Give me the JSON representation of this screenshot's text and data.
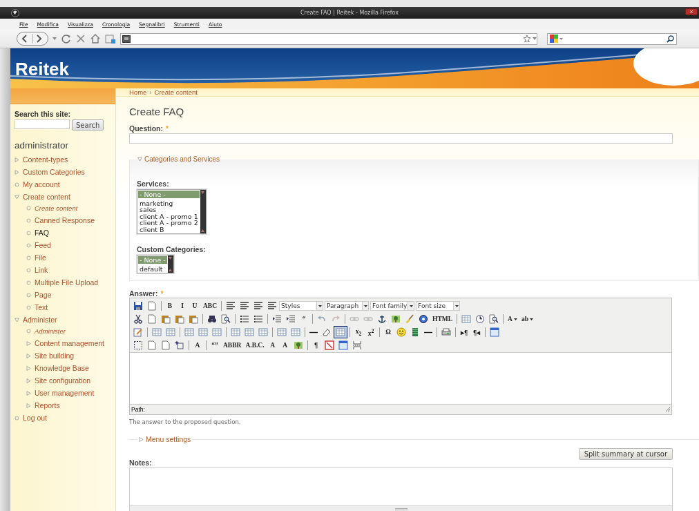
{
  "browser": {
    "title": "Create FAQ | Reitek - Mozilla Firefox",
    "menu": [
      "File",
      "Modifica",
      "Visualizza",
      "Cronologia",
      "Segnalibri",
      "Strumenti",
      "Aiuto"
    ]
  },
  "site": {
    "logo": "Reitek",
    "breadcrumb": {
      "items": [
        "Home",
        "Create content"
      ],
      "separator": "›"
    }
  },
  "sidebar": {
    "search_label": "Search this site:",
    "search_button": "Search",
    "user": "administrator",
    "menu": [
      {
        "label": "Content-types",
        "kind": "branch",
        "expanded": false,
        "selected": false
      },
      {
        "label": "Custom Categories",
        "kind": "branch",
        "expanded": false,
        "selected": false
      },
      {
        "label": "My account",
        "kind": "leaf",
        "selected": false
      },
      {
        "label": "Create content",
        "kind": "branch",
        "expanded": true,
        "selected": false,
        "children": [
          {
            "label": "Create content",
            "kind": "overview",
            "selected": false
          },
          {
            "label": "Canned Response",
            "kind": "leaf",
            "selected": false
          },
          {
            "label": "FAQ",
            "kind": "leaf",
            "selected": true
          },
          {
            "label": "Feed",
            "kind": "leaf",
            "selected": false
          },
          {
            "label": "File",
            "kind": "leaf",
            "selected": false
          },
          {
            "label": "Link",
            "kind": "leaf",
            "selected": false
          },
          {
            "label": "Multiple File Upload",
            "kind": "leaf",
            "selected": false
          },
          {
            "label": "Page",
            "kind": "leaf",
            "selected": false
          },
          {
            "label": "Text",
            "kind": "leaf",
            "selected": false
          }
        ]
      },
      {
        "label": "Administer",
        "kind": "branch",
        "expanded": true,
        "selected": false,
        "children": [
          {
            "label": "Administer",
            "kind": "overview",
            "selected": false
          },
          {
            "label": "Content management",
            "kind": "branch",
            "expanded": false,
            "selected": false
          },
          {
            "label": "Site building",
            "kind": "branch",
            "expanded": false,
            "selected": false
          },
          {
            "label": "Knowledge Base",
            "kind": "branch",
            "expanded": false,
            "selected": false
          },
          {
            "label": "Site configuration",
            "kind": "branch",
            "expanded": false,
            "selected": false
          },
          {
            "label": "User management",
            "kind": "branch",
            "expanded": false,
            "selected": false
          },
          {
            "label": "Reports",
            "kind": "branch",
            "expanded": false,
            "selected": false
          }
        ]
      },
      {
        "label": "Log out",
        "kind": "leaf",
        "selected": false
      }
    ]
  },
  "form": {
    "title": "Create FAQ",
    "question_label": "Question:",
    "required_mark": "*",
    "categories": {
      "legend": "Categories and Services",
      "expanded": true,
      "services": {
        "label": "Services:",
        "options": [
          {
            "label": "- None -",
            "selected": true
          },
          {
            "label": "marketing",
            "selected": false
          },
          {
            "label": "sales",
            "selected": false
          },
          {
            "label": "client A - promo 1",
            "selected": false
          },
          {
            "label": "client A - promo 2",
            "selected": false
          },
          {
            "label": "client B",
            "selected": false
          }
        ]
      },
      "custom_categories": {
        "label": "Custom Categories:",
        "options": [
          {
            "label": "- None -",
            "selected": true
          },
          {
            "label": "default",
            "selected": false
          }
        ]
      }
    },
    "answer_label": "Answer:",
    "toolbar": [
      [
        {
          "kind": "icon",
          "on": false
        },
        {
          "kind": "icon",
          "on": false
        },
        {
          "kind": "separator"
        },
        {
          "kind": "glyph",
          "text": "B",
          "on": false
        },
        {
          "kind": "glyph",
          "text": "I",
          "on": false
        },
        {
          "kind": "glyph",
          "text": "U",
          "on": false
        },
        {
          "kind": "glyph",
          "text": "ABC",
          "on": false
        },
        {
          "kind": "separator"
        },
        {
          "kind": "icon",
          "on": false
        },
        {
          "kind": "icon",
          "on": false
        },
        {
          "kind": "icon",
          "on": false
        },
        {
          "kind": "icon",
          "on": false
        },
        {
          "kind": "dropdown",
          "label": "Styles"
        },
        {
          "kind": "dropdown",
          "label": "Paragraph"
        },
        {
          "kind": "dropdown",
          "label": "Font family"
        },
        {
          "kind": "dropdown",
          "label": "Font size"
        }
      ],
      [
        {
          "kind": "icon",
          "on": false
        },
        {
          "kind": "icon",
          "on": false
        },
        {
          "kind": "icon",
          "on": false
        },
        {
          "kind": "icon",
          "on": false
        },
        {
          "kind": "icon",
          "on": false
        },
        {
          "kind": "separator"
        },
        {
          "kind": "icon",
          "on": false
        },
        {
          "kind": "icon",
          "on": false
        },
        {
          "kind": "separator"
        },
        {
          "kind": "icon",
          "on": false
        },
        {
          "kind": "icon",
          "on": false
        },
        {
          "kind": "separator"
        },
        {
          "kind": "icon",
          "on": false
        },
        {
          "kind": "icon",
          "on": false
        },
        {
          "kind": "glyph",
          "text": "“",
          "on": false
        },
        {
          "kind": "separator"
        },
        {
          "kind": "icon",
          "on": false
        },
        {
          "kind": "icon",
          "on": false
        },
        {
          "kind": "separator"
        },
        {
          "kind": "icon",
          "on": false
        },
        {
          "kind": "icon",
          "on": false
        },
        {
          "kind": "icon",
          "on": false
        },
        {
          "kind": "icon",
          "on": false
        },
        {
          "kind": "icon",
          "on": false
        },
        {
          "kind": "icon",
          "on": false
        },
        {
          "kind": "glyph",
          "text": "HTML",
          "on": false
        },
        {
          "kind": "separator"
        },
        {
          "kind": "icon",
          "on": false
        },
        {
          "kind": "icon",
          "on": false
        },
        {
          "kind": "icon",
          "on": false
        },
        {
          "kind": "separator"
        },
        {
          "kind": "menuglyph",
          "text": "A",
          "on": false
        },
        {
          "kind": "menuglyph",
          "text": "ab",
          "on": false
        }
      ],
      [
        {
          "kind": "icon",
          "on": false
        },
        {
          "kind": "separator"
        },
        {
          "kind": "icon",
          "on": false
        },
        {
          "kind": "icon",
          "on": false
        },
        {
          "kind": "separator"
        },
        {
          "kind": "icon",
          "on": false
        },
        {
          "kind": "icon",
          "on": false
        },
        {
          "kind": "icon",
          "on": false
        },
        {
          "kind": "separator"
        },
        {
          "kind": "icon",
          "on": false
        },
        {
          "kind": "icon",
          "on": false
        },
        {
          "kind": "icon",
          "on": false
        },
        {
          "kind": "separator"
        },
        {
          "kind": "icon",
          "on": false
        },
        {
          "kind": "icon",
          "on": false
        },
        {
          "kind": "separator"
        },
        {
          "kind": "icon",
          "on": false
        },
        {
          "kind": "icon",
          "on": false
        },
        {
          "kind": "icon",
          "on": true
        },
        {
          "kind": "separator"
        },
        {
          "kind": "glyph",
          "text": "x$_{2}$",
          "on": false
        },
        {
          "kind": "glyph",
          "text": "x$^{2}$",
          "on": false
        },
        {
          "kind": "separator"
        },
        {
          "kind": "glyph",
          "text": "Ω",
          "on": false
        },
        {
          "kind": "icon",
          "on": false
        },
        {
          "kind": "icon",
          "on": false
        },
        {
          "kind": "icon",
          "on": false
        },
        {
          "kind": "separator"
        },
        {
          "kind": "icon",
          "on": false
        },
        {
          "kind": "separator"
        },
        {
          "kind": "glyph",
          "text": "▸¶",
          "on": false
        },
        {
          "kind": "glyph",
          "text": "¶◂",
          "on": false
        },
        {
          "kind": "separator"
        },
        {
          "kind": "icon",
          "on": false
        }
      ],
      [
        {
          "kind": "icon",
          "on": false
        },
        {
          "kind": "icon",
          "on": false
        },
        {
          "kind": "icon",
          "on": false
        },
        {
          "kind": "icon",
          "on": false
        },
        {
          "kind": "separator"
        },
        {
          "kind": "glyph",
          "text": "A",
          "on": false
        },
        {
          "kind": "separator"
        },
        {
          "kind": "glyph",
          "text": "“”",
          "on": false
        },
        {
          "kind": "glyph",
          "text": "ABBR",
          "on": false
        },
        {
          "kind": "glyph",
          "text": "A.B.C.",
          "on": false
        },
        {
          "kind": "glyph",
          "text": "A",
          "on": false
        },
        {
          "kind": "glyph",
          "text": "A",
          "on": false
        },
        {
          "kind": "icon",
          "on": false
        },
        {
          "kind": "separator"
        },
        {
          "kind": "glyph",
          "text": "¶",
          "on": false
        },
        {
          "kind": "icon",
          "on": false
        },
        {
          "kind": "icon",
          "on": false
        },
        {
          "kind": "icon",
          "on": false
        }
      ]
    ],
    "path_label": "Path:",
    "answer_description": "The answer to the proposed question.",
    "menu_settings": {
      "legend": "Menu settings",
      "expanded": false
    },
    "split_button": "Split summary at cursor",
    "notes_label": "Notes:"
  }
}
